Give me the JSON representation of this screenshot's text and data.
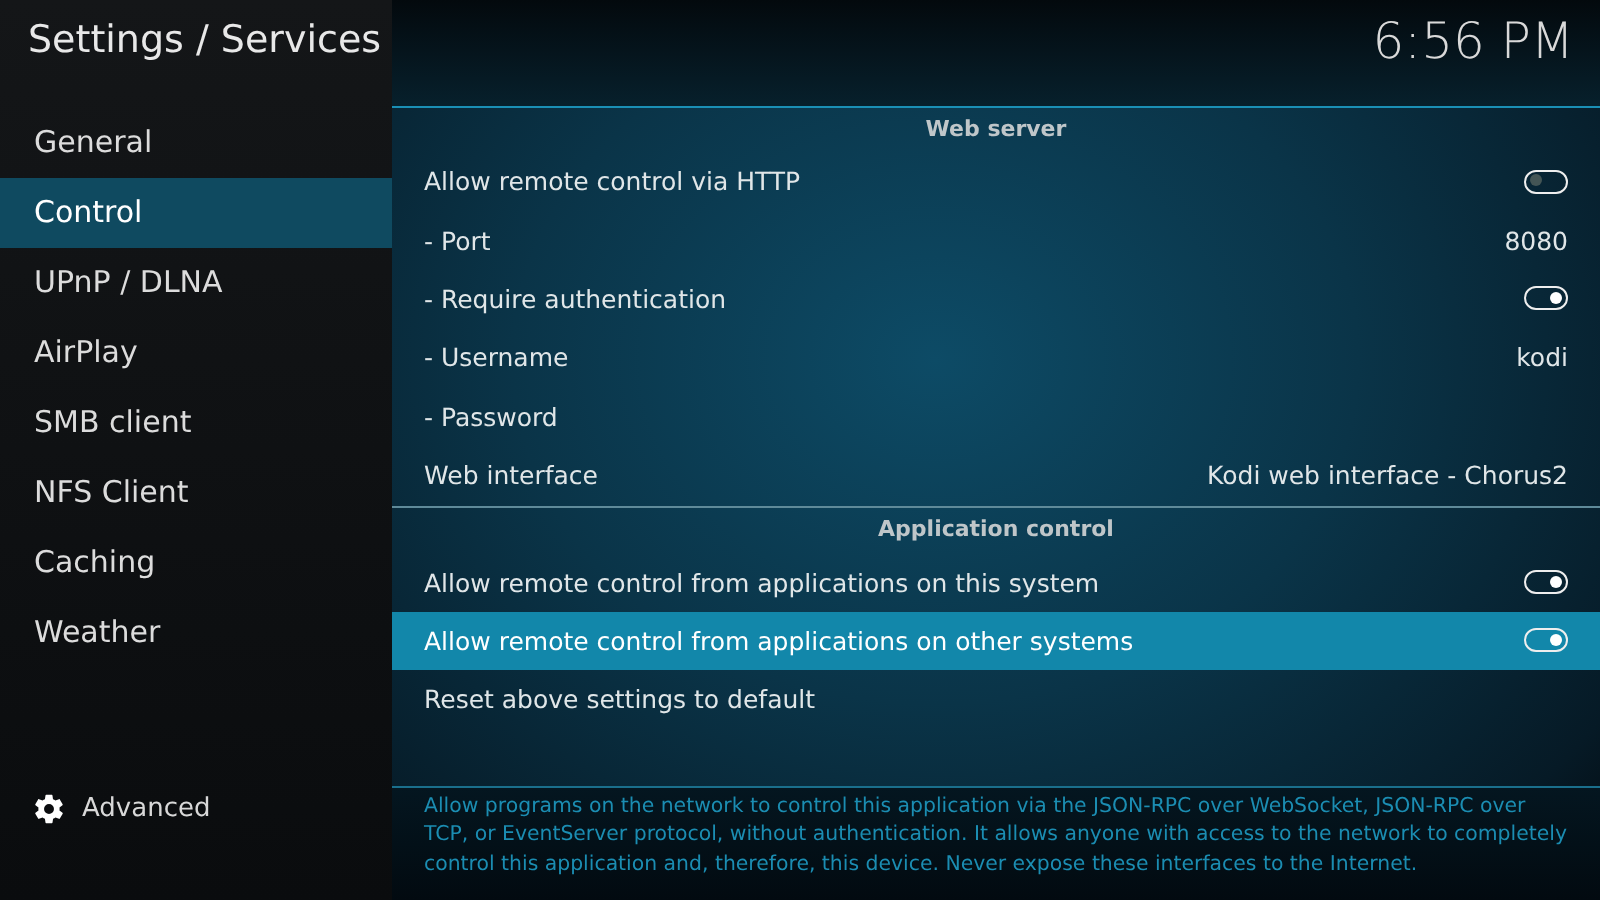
{
  "header": {
    "title": "Settings / Services",
    "clock": "6:56 PM"
  },
  "sidebar": {
    "items": [
      {
        "label": "General",
        "selected": false
      },
      {
        "label": "Control",
        "selected": true
      },
      {
        "label": "UPnP / DLNA",
        "selected": false
      },
      {
        "label": "AirPlay",
        "selected": false
      },
      {
        "label": "SMB client",
        "selected": false
      },
      {
        "label": "NFS Client",
        "selected": false
      },
      {
        "label": "Caching",
        "selected": false
      },
      {
        "label": "Weather",
        "selected": false
      }
    ],
    "footer": {
      "label": "Advanced"
    }
  },
  "sections": [
    {
      "title": "Web server",
      "settings": [
        {
          "kind": "toggle",
          "label": "Allow remote control via HTTP",
          "on": false,
          "selected": false
        },
        {
          "kind": "value",
          "label": "- Port",
          "value": "8080",
          "selected": false
        },
        {
          "kind": "toggle",
          "label": "- Require authentication",
          "on": true,
          "selected": false
        },
        {
          "kind": "value",
          "label": "- Username",
          "value": "kodi",
          "selected": false
        },
        {
          "kind": "plain",
          "label": "- Password",
          "selected": false
        },
        {
          "kind": "value",
          "label": "Web interface",
          "value": "Kodi web interface - Chorus2",
          "selected": false
        }
      ]
    },
    {
      "title": "Application control",
      "settings": [
        {
          "kind": "toggle",
          "label": "Allow remote control from applications on this system",
          "on": true,
          "selected": false
        },
        {
          "kind": "toggle",
          "label": "Allow remote control from applications on other systems",
          "on": true,
          "selected": true
        },
        {
          "kind": "plain",
          "label": "Reset above settings to default",
          "selected": false
        }
      ]
    }
  ],
  "description": "Allow programs on the network to control this application via the JSON-RPC over WebSocket, JSON-RPC over TCP, or EventServer protocol, without authentication. It allows anyone with access to the network to completely control this application and, therefore, this device. Never expose these interfaces to the Internet."
}
